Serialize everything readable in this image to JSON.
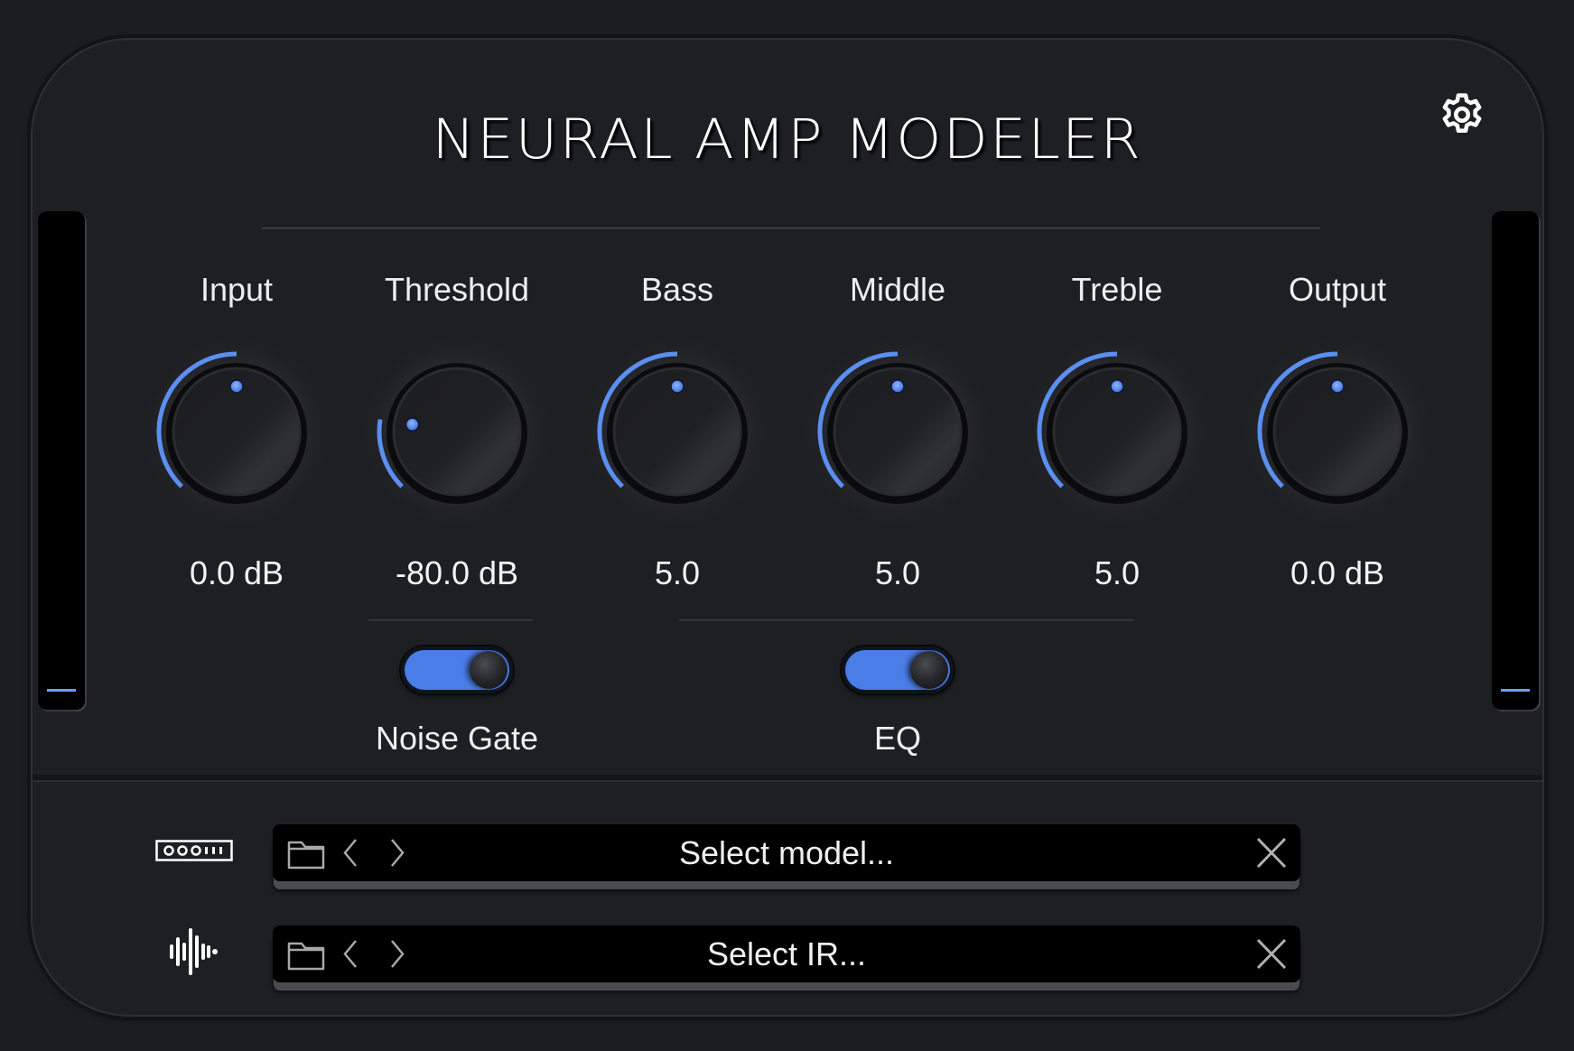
{
  "app": {
    "title": "NEURAL AMP MODELER",
    "accent_color": "#5b8ff0",
    "settings_icon": "gear-icon"
  },
  "knobs": [
    {
      "id": "input",
      "label": "Input",
      "value_text": "0.0 dB",
      "position": 0.5
    },
    {
      "id": "threshold",
      "label": "Threshold",
      "value_text": "-80.0 dB",
      "position": 0.2
    },
    {
      "id": "bass",
      "label": "Bass",
      "value_text": "5.0",
      "position": 0.5
    },
    {
      "id": "middle",
      "label": "Middle",
      "value_text": "5.0",
      "position": 0.5
    },
    {
      "id": "treble",
      "label": "Treble",
      "value_text": "5.0",
      "position": 0.5
    },
    {
      "id": "output",
      "label": "Output",
      "value_text": "0.0 dB",
      "position": 0.5
    }
  ],
  "toggles": [
    {
      "id": "noise-gate",
      "label": "Noise Gate",
      "on": true
    },
    {
      "id": "eq",
      "label": "EQ",
      "on": true
    }
  ],
  "meters": {
    "input_level": 0.0,
    "output_level": 0.0
  },
  "model_loader": {
    "row_icon": "amp-head-icon",
    "placeholder": "Select model...",
    "folder_icon": "folder-icon",
    "prev_icon": "chevron-left-icon",
    "next_icon": "chevron-right-icon",
    "clear_icon": "close-icon"
  },
  "ir_loader": {
    "row_icon": "waveform-icon",
    "placeholder": "Select IR...",
    "folder_icon": "folder-icon",
    "prev_icon": "chevron-left-icon",
    "next_icon": "chevron-right-icon",
    "clear_icon": "close-icon"
  }
}
